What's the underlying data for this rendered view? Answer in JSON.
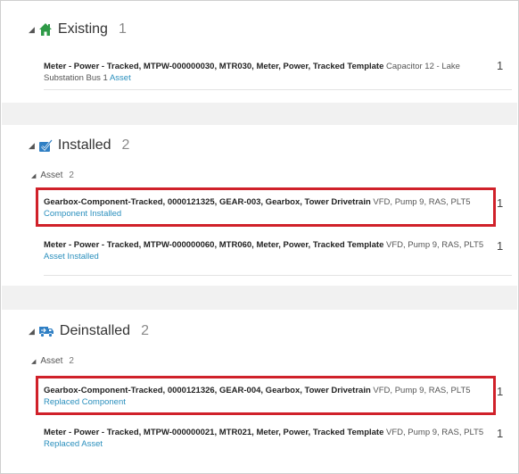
{
  "sections": [
    {
      "title": "Existing",
      "count": "1",
      "rows": [
        {
          "bold": "Meter - Power - Tracked, MTPW-000000030, MTR030, Meter, Power, Tracked Template",
          "rest": " Capacitor 12 - Lake Substation Bus 1 ",
          "link": "Asset",
          "qty": "1"
        }
      ]
    },
    {
      "title": "Installed",
      "count": "2",
      "group": {
        "label": "Asset",
        "count": "2"
      },
      "rows": [
        {
          "bold": "Gearbox-Component-Tracked, 0000121325, GEAR-003, Gearbox, Tower Drivetrain",
          "rest": " VFD, Pump 9, RAS, PLT5 ",
          "link": "Component Installed",
          "qty": "1"
        },
        {
          "bold": "Meter - Power - Tracked, MTPW-000000060, MTR060, Meter, Power, Tracked Template",
          "rest": " VFD, Pump 9, RAS, PLT5 ",
          "link": "Asset Installed",
          "qty": "1"
        }
      ]
    },
    {
      "title": "Deinstalled",
      "count": "2",
      "group": {
        "label": "Asset",
        "count": "2"
      },
      "rows": [
        {
          "bold": "Gearbox-Component-Tracked, 0000121326, GEAR-004, Gearbox, Tower Drivetrain",
          "rest": " VFD, Pump 9, RAS, PLT5 ",
          "link": "Replaced Component",
          "qty": "1"
        },
        {
          "bold": "Meter - Power - Tracked, MTPW-000000021, MTR021, Meter, Power, Tracked Template",
          "rest": " VFD, Pump 9, RAS, PLT5 ",
          "link": "Replaced Asset",
          "qty": "1"
        }
      ]
    }
  ],
  "icons": {
    "existing": "house-icon",
    "installed": "checked-box-icon",
    "deinstalled": "truck-icon"
  },
  "colors": {
    "accent_green": "#2e9a47",
    "icon_blue": "#2f7fc4",
    "link": "#2a8fbd",
    "highlight": "#d0212a"
  }
}
